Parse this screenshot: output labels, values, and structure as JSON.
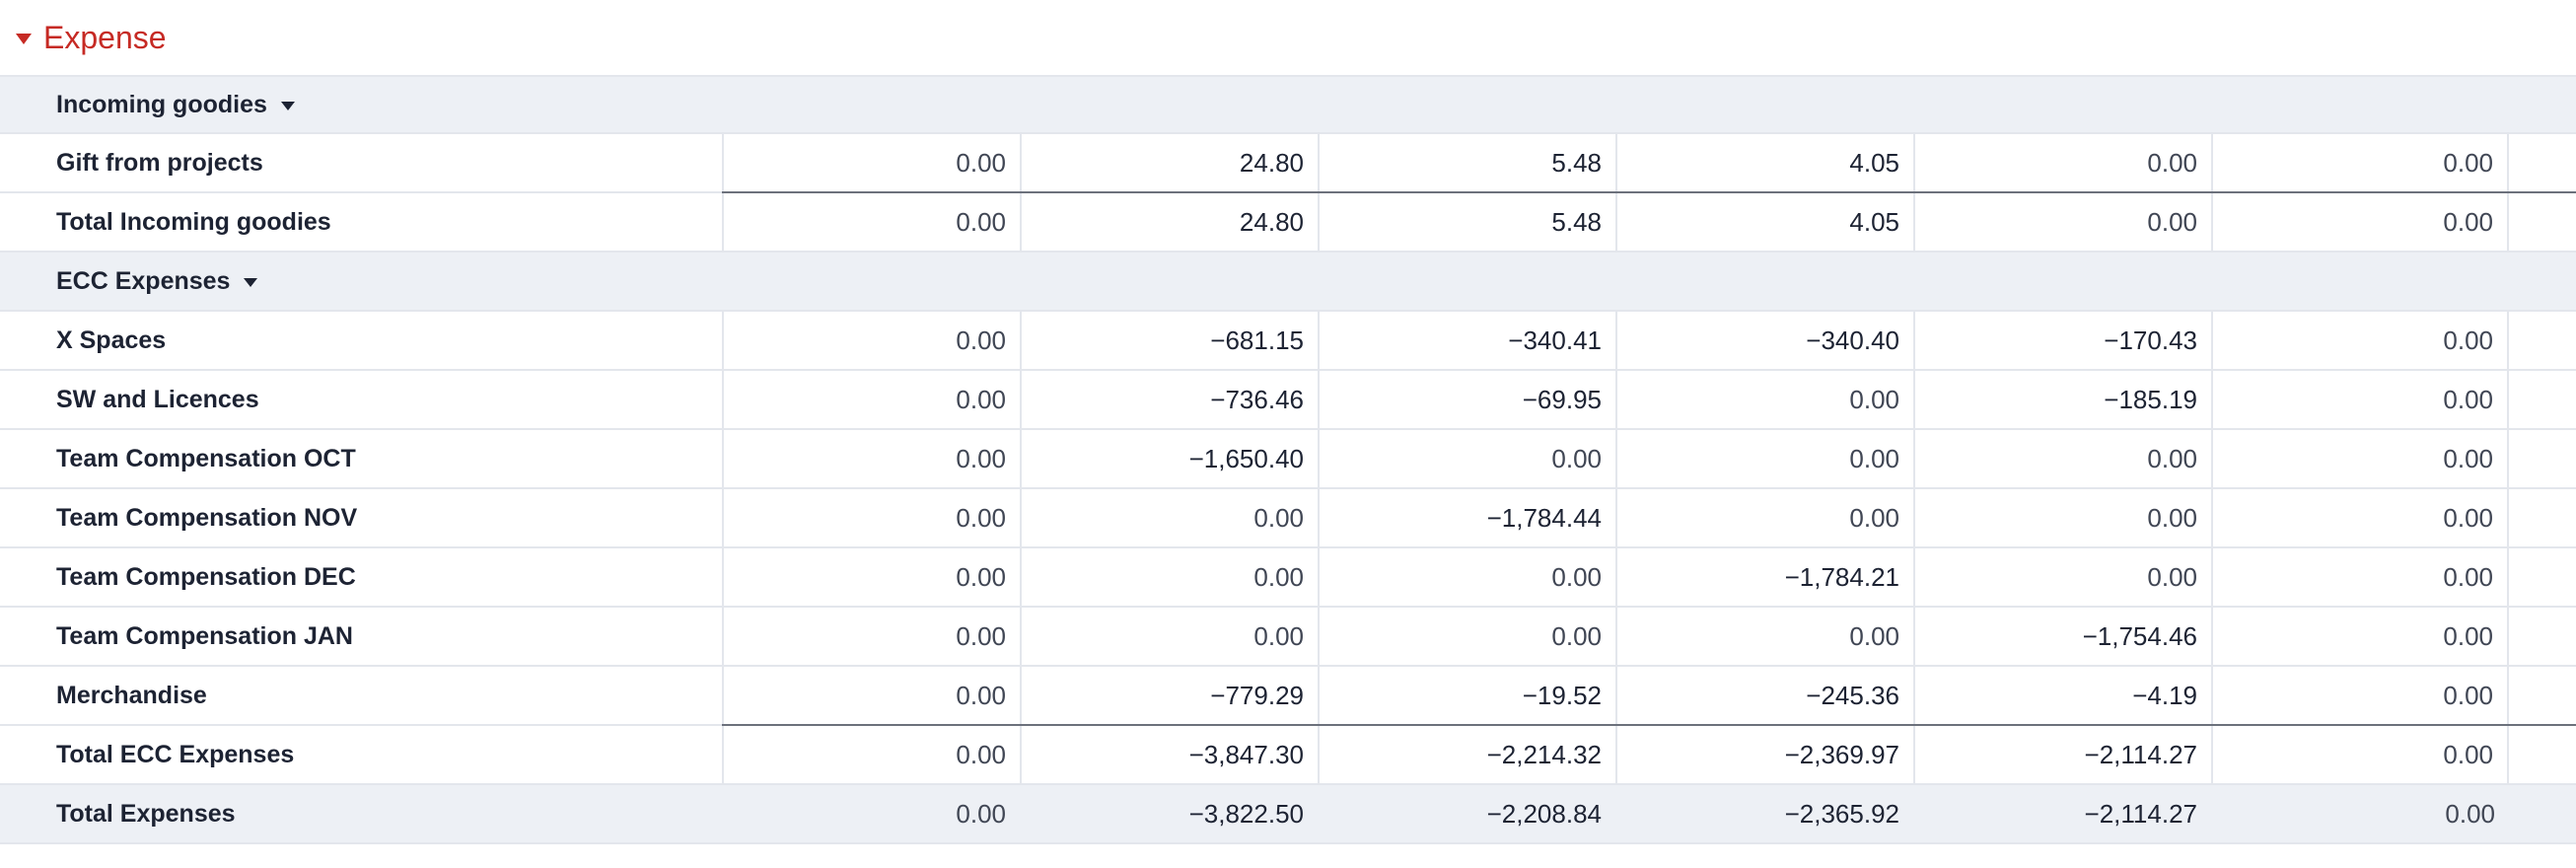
{
  "section": {
    "title": "Expense"
  },
  "incoming": {
    "title": "Incoming goodies",
    "rows": [
      {
        "label": "Gift from projects",
        "values": [
          "0.00",
          "24.80",
          "5.48",
          "4.05",
          "0.00",
          "0.00"
        ]
      }
    ],
    "total": {
      "label": "Total Incoming goodies",
      "values": [
        "0.00",
        "24.80",
        "5.48",
        "4.05",
        "0.00",
        "0.00"
      ]
    }
  },
  "ecc": {
    "title": "ECC Expenses",
    "rows": [
      {
        "label": "X Spaces",
        "values": [
          "0.00",
          "−681.15",
          "−340.41",
          "−340.40",
          "−170.43",
          "0.00"
        ]
      },
      {
        "label": "SW and Licences",
        "values": [
          "0.00",
          "−736.46",
          "−69.95",
          "0.00",
          "−185.19",
          "0.00"
        ]
      },
      {
        "label": "Team Compensation OCT",
        "values": [
          "0.00",
          "−1,650.40",
          "0.00",
          "0.00",
          "0.00",
          "0.00"
        ]
      },
      {
        "label": "Team Compensation NOV",
        "values": [
          "0.00",
          "0.00",
          "−1,784.44",
          "0.00",
          "0.00",
          "0.00"
        ]
      },
      {
        "label": "Team Compensation DEC",
        "values": [
          "0.00",
          "0.00",
          "0.00",
          "−1,784.21",
          "0.00",
          "0.00"
        ]
      },
      {
        "label": "Team Compensation JAN",
        "values": [
          "0.00",
          "0.00",
          "0.00",
          "0.00",
          "−1,754.46",
          "0.00"
        ]
      },
      {
        "label": "Merchandise",
        "values": [
          "0.00",
          "−779.29",
          "−19.52",
          "−245.36",
          "−4.19",
          "0.00"
        ]
      }
    ],
    "total": {
      "label": "Total ECC Expenses",
      "values": [
        "0.00",
        "−3,847.30",
        "−2,214.32",
        "−2,369.97",
        "−2,114.27",
        "0.00"
      ]
    }
  },
  "grand_total": {
    "label": "Total Expenses",
    "values": [
      "0.00",
      "−3,822.50",
      "−2,208.84",
      "−2,365.92",
      "−2,114.27",
      "0.00"
    ]
  },
  "colors": {
    "section_title": "#c62a24",
    "group_background": "#edf0f5",
    "text": "#1d2333",
    "number_text": "#404654",
    "grid": "#e3e6ec",
    "total_rule": "#6c717c"
  },
  "icons": {
    "section_toggle": "caret-down-icon",
    "group_toggle": "caret-down-icon"
  }
}
